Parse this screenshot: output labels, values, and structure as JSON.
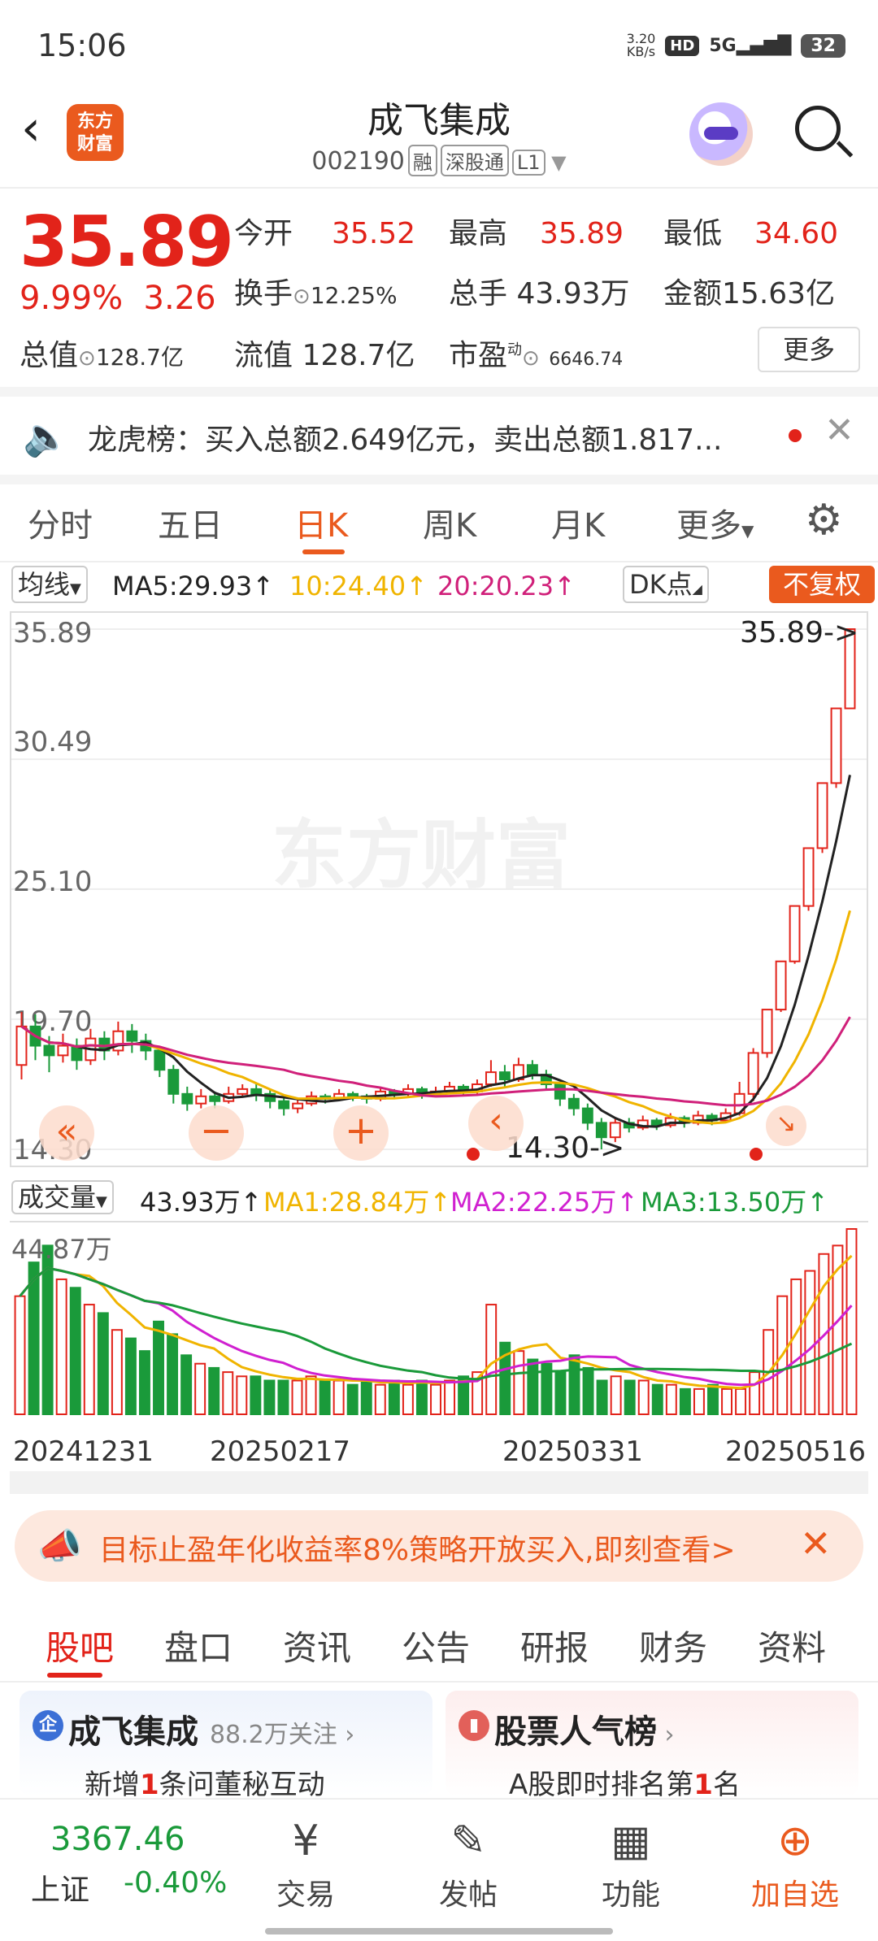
{
  "status_bar": {
    "time": "15:06",
    "net_speed_value": "3.20",
    "net_speed_unit": "KB/s",
    "hd": "HD",
    "signal": "5G",
    "battery": "32"
  },
  "header": {
    "back_icon": "back-arrow-icon",
    "logo_text": "东方\n财富",
    "title": "成飞集成",
    "code": "002190",
    "tags": [
      "融",
      "深股通",
      "L1"
    ]
  },
  "quote": {
    "price": "35.89",
    "change_pct": "9.99%",
    "change_amt": "3.26",
    "open_label": "今开",
    "open": "35.52",
    "high_label": "最高",
    "high": "35.89",
    "low_label": "最低",
    "low": "34.60",
    "turnover_label": "换手",
    "turnover": "12.25%",
    "volume_label": "总手",
    "volume": "43.93万",
    "amount_label": "金额",
    "amount": "15.63亿",
    "mcap_label": "总值",
    "mcap": "128.7亿",
    "float_label": "流值",
    "float": "128.7亿",
    "pe_label": "市盈",
    "pe_sup": "动",
    "pe": "6646.74",
    "more_button": "更多"
  },
  "dragon_tiger": {
    "text": "龙虎榜：买入总额2.649亿元，卖出总额1.817..."
  },
  "period_tabs": [
    "分时",
    "五日",
    "日K",
    "周K",
    "月K",
    "更多"
  ],
  "period_tabs_active": 2,
  "ma_row": {
    "indicator_label": "均线",
    "ma5": "MA5:29.93↑",
    "ma10": "10:24.40↑",
    "ma20": "20:20.23↑",
    "dk_label": "DK点",
    "adjust_label": "不复权",
    "colors": {
      "ma5": "#222222",
      "ma10": "#f0b400",
      "ma20": "#d0207a"
    }
  },
  "chart_labels": {
    "y_ticks": [
      "35.89",
      "30.49",
      "25.10",
      "19.70",
      "14.30"
    ],
    "last_price_marker": "35.89->",
    "low_marker": "14.30->",
    "watermark": "东方财富"
  },
  "volume_row": {
    "label": "成交量",
    "vol": "43.93万↑",
    "ma1": "MA1:28.84万↑",
    "ma2": "MA2:22.25万↑",
    "ma3": "MA3:13.50万↑",
    "max_tick": "44.87万",
    "colors": {
      "ma1": "#f0b400",
      "ma2": "#d020d0",
      "ma3": "#1a9a3a"
    }
  },
  "x_dates": [
    "20241231",
    "20250217",
    "20250331",
    "20250516"
  ],
  "promo": {
    "text": "目标止盈年化收益率8%策略开放买入,即刻查看>"
  },
  "bottom_tabs": [
    "股吧",
    "盘口",
    "资讯",
    "公告",
    "研报",
    "财务",
    "资料"
  ],
  "bottom_tabs_active": 0,
  "cards": {
    "left_title": "成飞集成",
    "left_follow": "88.2万关注",
    "left_sub_pre": "新增",
    "left_sub_num": "1",
    "left_sub_post": "条问董秘互动",
    "right_title": "股票人气榜",
    "right_sub_pre": "A股即时排名第",
    "right_sub_num": "1",
    "right_sub_post": "名"
  },
  "bottom_nav": {
    "index_value": "3367.46",
    "index_name": "上证",
    "index_change": "-0.40%",
    "items": [
      "交易",
      "发帖",
      "功能",
      "加自选"
    ]
  },
  "chart_data": {
    "type": "candlestick",
    "note_series": "daily K-line with MA5/MA10/MA20 and volume bars",
    "y_range": [
      14.3,
      35.89
    ],
    "ma_colors": [
      "#222222",
      "#f0b400",
      "#d0207a"
    ],
    "candles": [
      [
        17.8,
        19.4,
        17.2,
        20.0
      ],
      [
        19.4,
        18.6,
        18.0,
        19.9
      ],
      [
        18.6,
        18.2,
        17.5,
        19.0
      ],
      [
        18.2,
        18.6,
        17.9,
        19.1
      ],
      [
        18.6,
        18.0,
        17.6,
        18.9
      ],
      [
        18.0,
        18.9,
        17.8,
        19.3
      ],
      [
        18.9,
        18.4,
        18.0,
        19.2
      ],
      [
        18.4,
        19.2,
        18.2,
        19.6
      ],
      [
        19.2,
        18.8,
        18.3,
        19.5
      ],
      [
        18.8,
        18.4,
        18.0,
        19.1
      ],
      [
        18.4,
        17.6,
        17.3,
        18.6
      ],
      [
        17.6,
        16.6,
        16.2,
        17.8
      ],
      [
        16.6,
        16.2,
        15.9,
        16.9
      ],
      [
        16.2,
        16.5,
        16.0,
        16.8
      ],
      [
        16.5,
        16.3,
        16.0,
        16.7
      ],
      [
        16.3,
        16.6,
        16.2,
        16.9
      ],
      [
        16.6,
        16.8,
        16.5,
        17.0
      ],
      [
        16.8,
        16.6,
        16.3,
        17.0
      ],
      [
        16.6,
        16.3,
        16.0,
        16.8
      ],
      [
        16.3,
        16.0,
        15.7,
        16.5
      ],
      [
        16.0,
        16.2,
        15.8,
        16.4
      ],
      [
        16.2,
        16.5,
        16.1,
        16.7
      ],
      [
        16.5,
        16.4,
        16.2,
        16.6
      ],
      [
        16.4,
        16.6,
        16.3,
        16.8
      ],
      [
        16.6,
        16.5,
        16.3,
        16.7
      ],
      [
        16.5,
        16.4,
        16.2,
        16.6
      ],
      [
        16.4,
        16.7,
        16.3,
        16.9
      ],
      [
        16.7,
        16.6,
        16.4,
        16.8
      ],
      [
        16.6,
        16.8,
        16.5,
        17.0
      ],
      [
        16.8,
        16.6,
        16.4,
        16.9
      ],
      [
        16.6,
        16.7,
        16.5,
        16.9
      ],
      [
        16.7,
        16.9,
        16.6,
        17.1
      ],
      [
        16.9,
        16.7,
        16.5,
        17.0
      ],
      [
        16.7,
        17.0,
        16.6,
        17.2
      ],
      [
        17.0,
        17.5,
        16.9,
        18.0
      ],
      [
        17.5,
        17.2,
        16.9,
        17.8
      ],
      [
        17.2,
        17.8,
        17.1,
        18.1
      ],
      [
        17.8,
        17.4,
        17.2,
        18.0
      ],
      [
        17.4,
        17.0,
        16.8,
        17.6
      ],
      [
        17.0,
        16.4,
        16.1,
        17.1
      ],
      [
        16.4,
        16.0,
        15.7,
        16.6
      ],
      [
        16.0,
        15.4,
        15.1,
        16.2
      ],
      [
        15.4,
        14.8,
        14.3,
        15.6
      ],
      [
        14.8,
        15.4,
        14.6,
        15.6
      ],
      [
        15.4,
        15.2,
        15.0,
        15.6
      ],
      [
        15.2,
        15.5,
        15.1,
        15.7
      ],
      [
        15.5,
        15.3,
        15.1,
        15.6
      ],
      [
        15.3,
        15.6,
        15.2,
        15.8
      ],
      [
        15.6,
        15.4,
        15.2,
        15.7
      ],
      [
        15.4,
        15.7,
        15.3,
        15.9
      ],
      [
        15.7,
        15.5,
        15.3,
        15.8
      ],
      [
        15.5,
        15.8,
        15.4,
        16.0
      ],
      [
        15.8,
        16.6,
        15.7,
        17.1
      ],
      [
        16.6,
        18.3,
        16.3,
        18.5
      ],
      [
        18.3,
        20.1,
        18.1,
        20.1
      ],
      [
        20.1,
        22.1,
        20.0,
        22.1
      ],
      [
        22.1,
        24.4,
        22.0,
        24.4
      ],
      [
        24.4,
        26.8,
        24.2,
        26.8
      ],
      [
        26.8,
        29.5,
        26.6,
        29.5
      ],
      [
        29.5,
        32.6,
        29.3,
        32.6
      ],
      [
        32.6,
        35.89,
        34.6,
        35.89
      ]
    ],
    "volume_wan": [
      28,
      36,
      40,
      32,
      30,
      26,
      24,
      20,
      18,
      15,
      22,
      19,
      14,
      12,
      11,
      10,
      9,
      9,
      8,
      8,
      8,
      9,
      8,
      8,
      7,
      8,
      7,
      8,
      7,
      8,
      7,
      8,
      9,
      10,
      26,
      17,
      15,
      13,
      12,
      10,
      14,
      11,
      8,
      9,
      8,
      8,
      7,
      7,
      6,
      6,
      7,
      6,
      6,
      10,
      20,
      28,
      32,
      34,
      38,
      40,
      43.93
    ]
  }
}
